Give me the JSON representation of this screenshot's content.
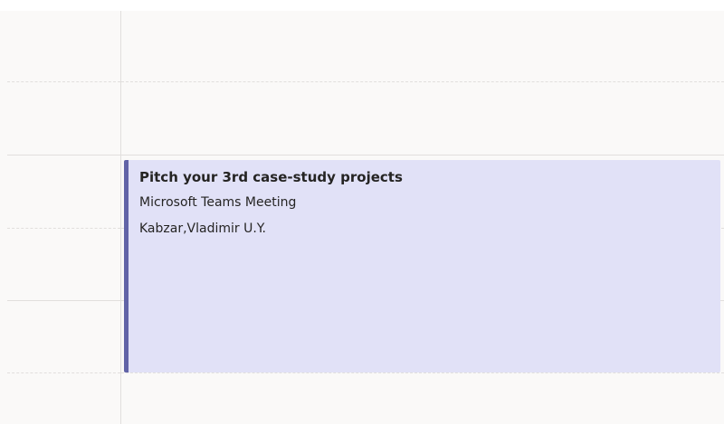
{
  "event": {
    "title": "Pitch your 3rd case-study projects",
    "location": "Microsoft Teams Meeting",
    "organizer": "Kabzar,Vladimir U.Y."
  },
  "colors": {
    "grid_background": "#faf9f8",
    "grid_line": "#e1dfdd",
    "event_background": "#e1e1f7",
    "event_accent": "#6264a7",
    "text": "#252423"
  }
}
